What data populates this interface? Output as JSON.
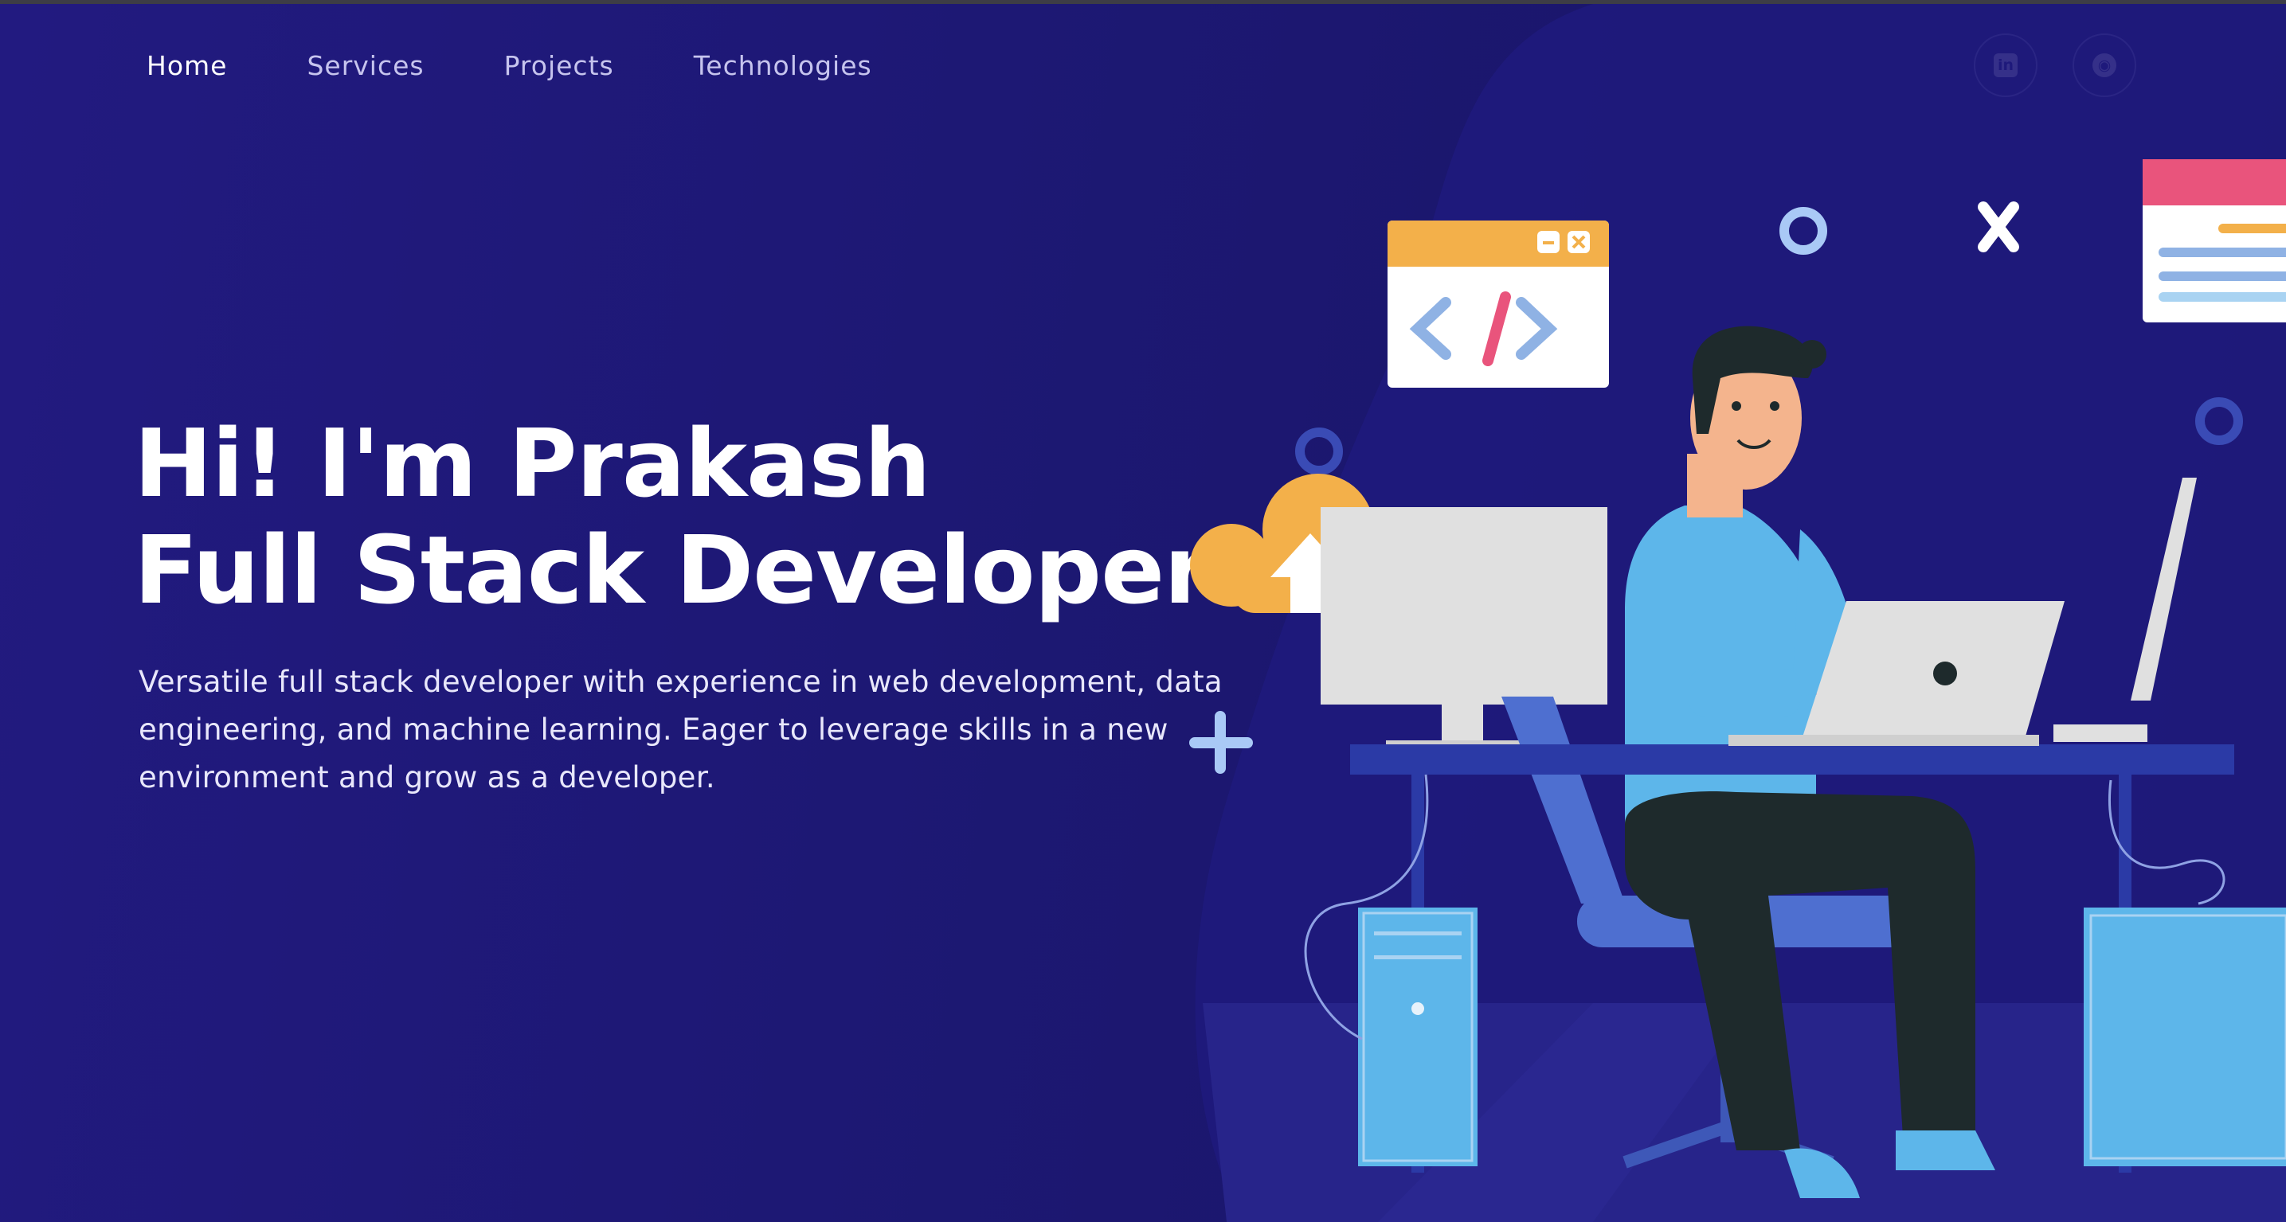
{
  "nav": {
    "items": [
      {
        "label": "Home",
        "active": true
      },
      {
        "label": "Services",
        "active": false
      },
      {
        "label": "Projects",
        "active": false
      },
      {
        "label": "Technologies",
        "active": false
      }
    ]
  },
  "social": [
    {
      "icon": "linkedin-icon",
      "glyph": "in"
    },
    {
      "icon": "github-icon",
      "glyph": "◉"
    }
  ],
  "hero": {
    "line1": "Hi! I'm Prakash",
    "line2": "Full Stack Developer",
    "intro": "Versatile full stack developer with experience in web development, data engineering, and machine learning. Eager to leverage skills in a new environment and grow as a developer."
  },
  "illustration": {
    "code_window_text": "</>"
  },
  "colors": {
    "background": "#1b1770",
    "accent_orange": "#f3b04a",
    "accent_blue": "#5db6ea",
    "accent_pink": "#e9547c"
  }
}
